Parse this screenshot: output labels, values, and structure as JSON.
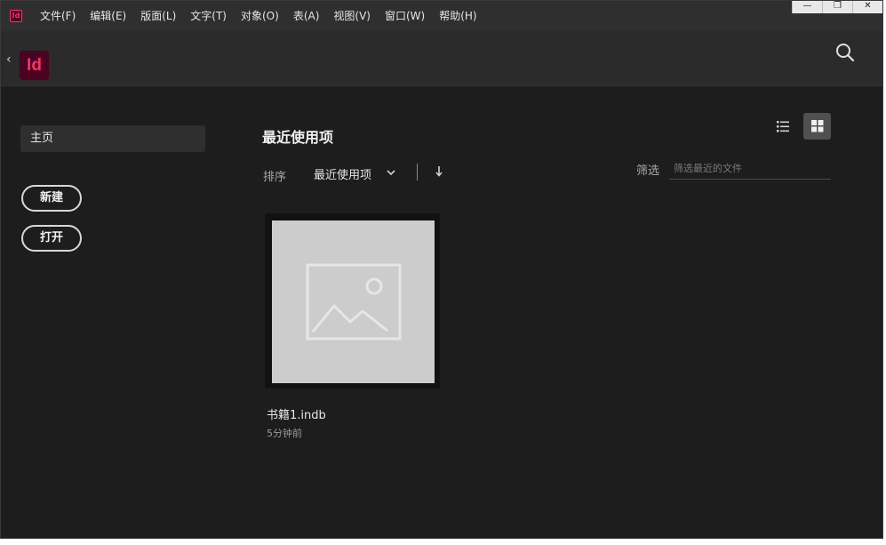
{
  "app": {
    "mini_icon": "Id",
    "logo": "Id"
  },
  "menu": [
    "文件(F)",
    "编辑(E)",
    "版面(L)",
    "文字(T)",
    "对象(O)",
    "表(A)",
    "视图(V)",
    "窗口(W)",
    "帮助(H)"
  ],
  "window_controls": {
    "minimize": "—",
    "maximize": "❐",
    "close": "✕"
  },
  "header": {
    "back": "‹"
  },
  "sidebar": {
    "home": "主页",
    "new_button": "新建",
    "open_button": "打开"
  },
  "main": {
    "title": "最近使用项",
    "sort_label": "排序",
    "sort_value": "最近使用项",
    "filter_label": "筛选",
    "filter_placeholder": "筛选最近的文件"
  },
  "files": [
    {
      "name": "书籍1.indb",
      "modified": "5分钟前"
    }
  ],
  "icons": {
    "search": "search-icon",
    "chevron": "chevron-down-icon",
    "sort": "arrow-down-icon",
    "list_view": "list-view-icon",
    "grid_view": "grid-view-icon",
    "thumbnail": "image-placeholder-icon"
  },
  "colors": {
    "brand": "#ff3366",
    "brand_bg": "#49021f",
    "background": "#1d1d1d"
  }
}
